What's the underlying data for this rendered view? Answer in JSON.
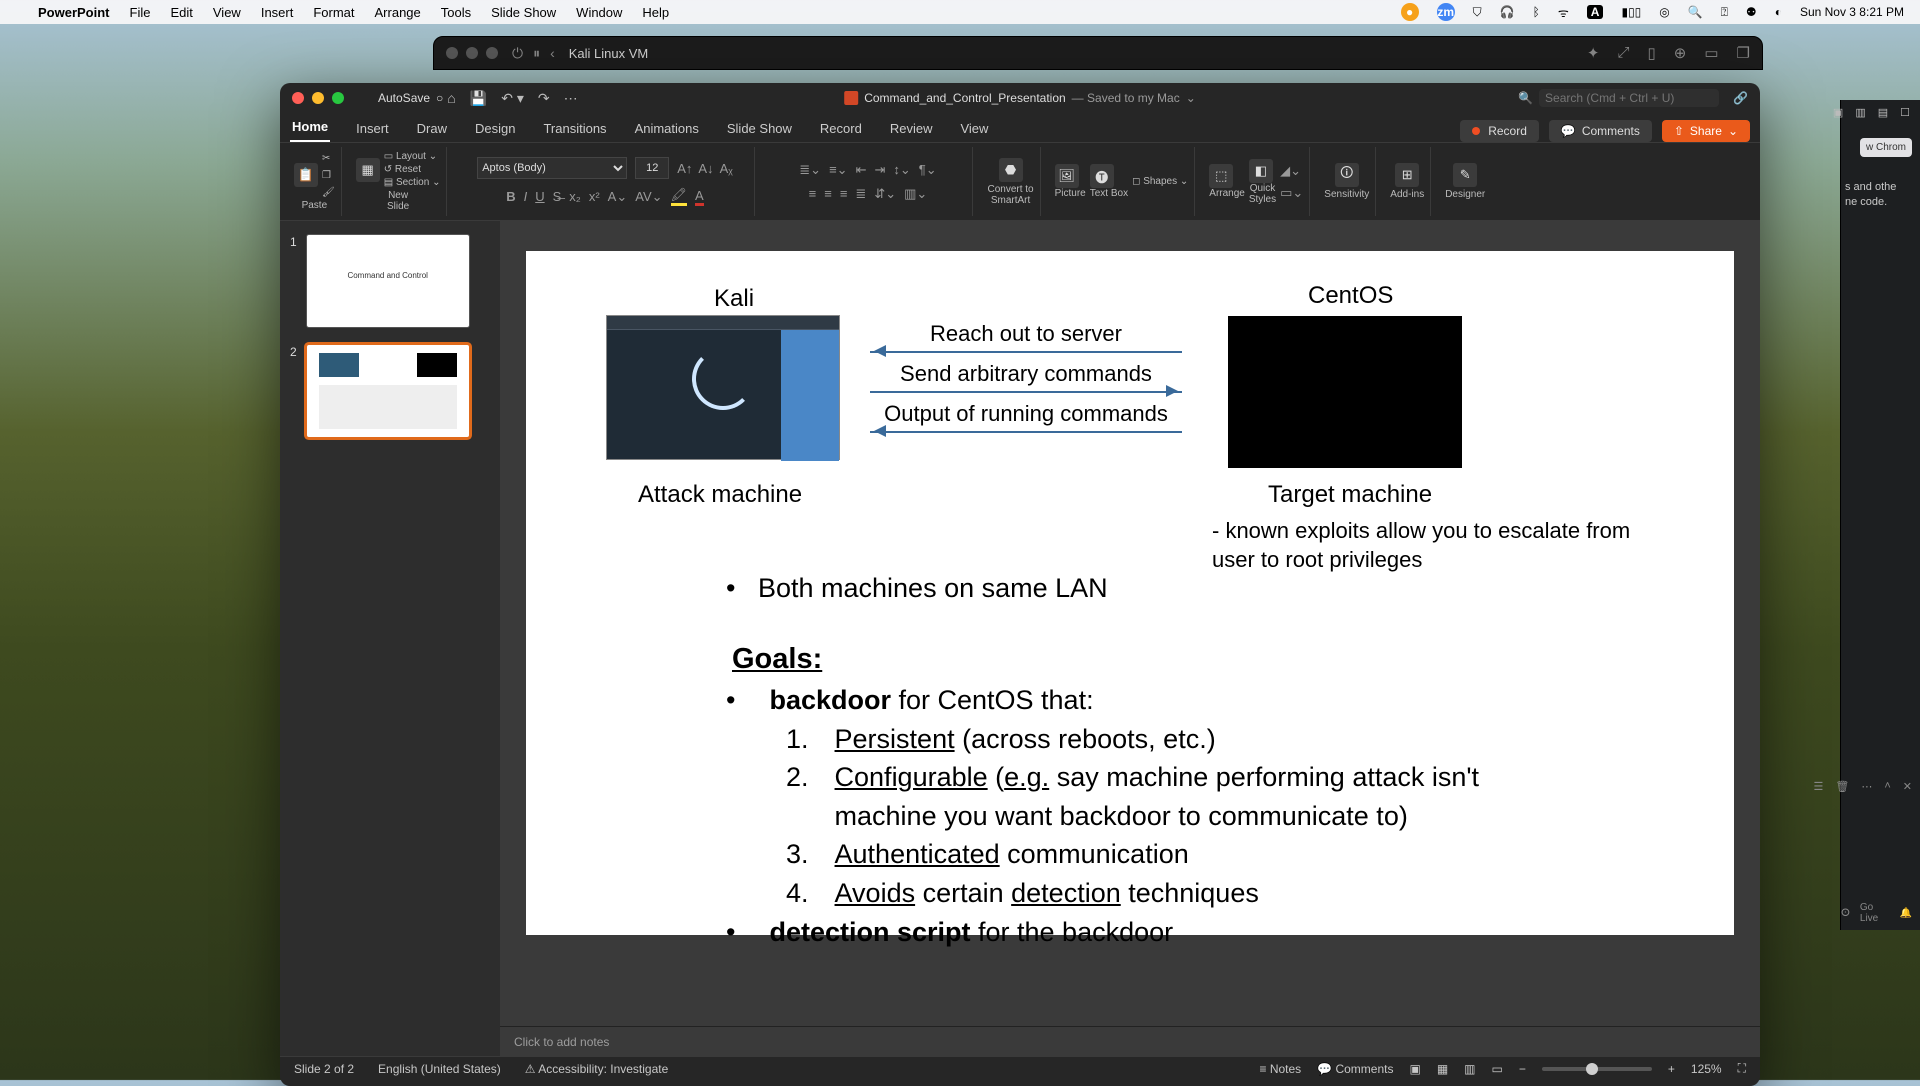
{
  "menubar": {
    "app": "PowerPoint",
    "items": [
      "File",
      "Edit",
      "View",
      "Insert",
      "Format",
      "Arrange",
      "Tools",
      "Slide Show",
      "Window",
      "Help"
    ],
    "time": "Sun Nov 3  8:21 PM"
  },
  "term": {
    "title": "Kali Linux VM"
  },
  "right_win": {
    "btn": "w Chrom",
    "text": "s and othe\nne code.",
    "golive": "Go Live"
  },
  "pp": {
    "autosave": "AutoSave",
    "doc": "Command_and_Control_Presentation",
    "saved": "— Saved to my Mac",
    "search_ph": "Search (Cmd + Ctrl + U)",
    "tabs": [
      "Home",
      "Insert",
      "Draw",
      "Design",
      "Transitions",
      "Animations",
      "Slide Show",
      "Record",
      "Review",
      "View"
    ],
    "active_tab": "Home",
    "record": "Record",
    "comments": "Comments",
    "share": "Share",
    "ribbon": {
      "paste": "Paste",
      "new_slide": "New\nSlide",
      "layout": "Layout",
      "reset": "Reset",
      "section": "Section",
      "font": "Aptos (Body)",
      "size": "12",
      "convert": "Convert to\nSmartArt",
      "picture": "Picture",
      "textbox": "Text Box",
      "shapes": "Shapes",
      "arrange": "Arrange",
      "quick": "Quick\nStyles",
      "sensitivity": "Sensitivity",
      "addins": "Add-ins",
      "designer": "Designer"
    },
    "thumbs": {
      "t1_text": "Command and Control",
      "n1": "1",
      "n2": "2"
    },
    "slide": {
      "kali": "Kali",
      "centos": "CentOS",
      "attack": "Attack machine",
      "target": "Target machine",
      "target_note": "- known exploits allow you to escalate from user to root privileges",
      "arrow1": "Reach out to server",
      "arrow2": "Send arbitrary commands",
      "arrow3": "Output of running commands",
      "lan": "Both machines on same LAN",
      "goals": "Goals:",
      "g1a": "backdoor",
      "g1b": " for CentOS that:",
      "n1a": "Persistent",
      "n1b": " (across reboots, etc.)",
      "n2a": "Configurable",
      "n2b": " (",
      "n2c": "e.g.",
      "n2d": " say machine performing attack isn't machine you want backdoor to communicate to)",
      "n3a": "Authenticated",
      "n3b": " communication",
      "n4a": "Avoids",
      "n4b": " certain ",
      "n4c": "detection",
      "n4d": " techniques",
      "g2a": "detection script",
      "g2b": " for the backdoor"
    },
    "notes": "Click to add notes",
    "status": {
      "slide": "Slide 2 of 2",
      "lang": "English (United States)",
      "acc": "Accessibility: Investigate",
      "notes": "Notes",
      "comments": "Comments",
      "zoom": "125%"
    }
  }
}
